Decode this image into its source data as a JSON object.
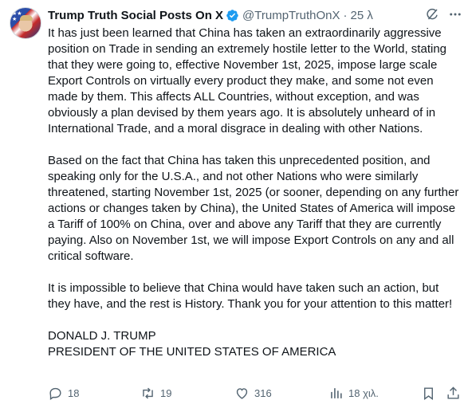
{
  "post": {
    "display_name": "Trump Truth Social Posts On X",
    "handle": "@TrumpTruthOnX",
    "separator": "·",
    "time": "25 λ",
    "paragraphs": [
      "It has just been learned that China has taken an extraordinarily aggressive position on Trade in sending an extremely hostile letter to the World, stating that they were going to, effective November 1st, 2025, impose large scale Export Controls on virtually every product they make, and some not even made by them. This affects ALL Countries, without exception, and was obviously a plan devised by them years ago. It is absolutely unheard of in International Trade, and a moral disgrace in dealing with other Nations.",
      "Based on the fact that China has taken this unprecedented position, and speaking only for the U.S.A., and not other Nations who were similarly threatened, starting November 1st, 2025 (or sooner, depending on any further actions or changes taken by China), the United States of America will impose a Tariff of 100% on China, over and above any Tariff that they are currently paying. Also on November 1st, we will impose Export Controls on any and all critical software.",
      "It is impossible to believe that China would have taken such an action, but they have, and the rest is History. Thank you for your attention to this matter!"
    ],
    "signature_name": "DONALD J. TRUMP",
    "signature_title": "PRESIDENT OF THE UNITED STATES OF AMERICA"
  },
  "actions": {
    "replies": "18",
    "reposts": "19",
    "likes": "316",
    "views": "18 χιλ."
  },
  "colors": {
    "text": "#0f1419",
    "muted": "#536471",
    "verified": "#1d9bf0"
  },
  "icons": [
    "verified-badge-icon",
    "grok-icon",
    "more-icon",
    "reply-icon",
    "repost-icon",
    "like-icon",
    "views-icon",
    "bookmark-icon",
    "share-icon"
  ]
}
